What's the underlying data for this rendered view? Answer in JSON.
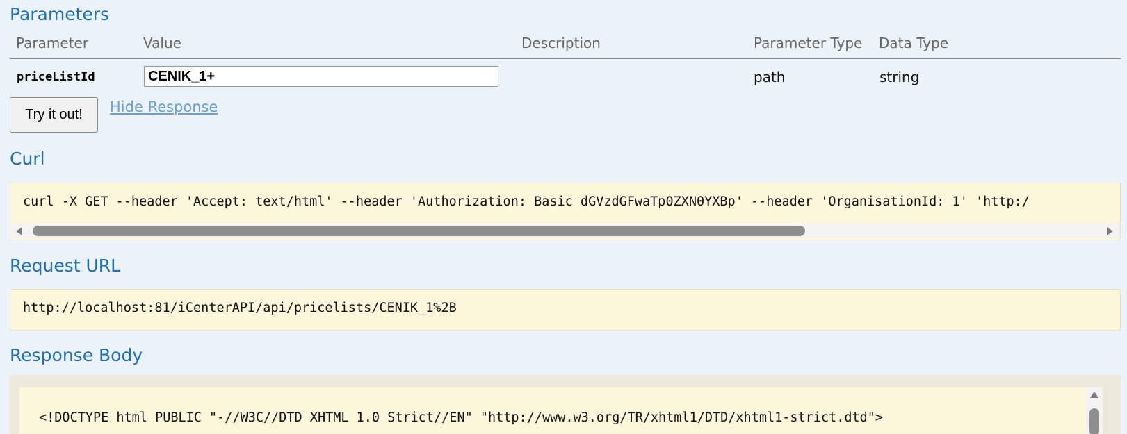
{
  "sections": {
    "parameters": "Parameters",
    "curl": "Curl",
    "request_url": "Request URL",
    "response_body": "Response Body"
  },
  "table": {
    "headers": [
      "Parameter",
      "Value",
      "Description",
      "Parameter Type",
      "Data Type"
    ],
    "rows": [
      {
        "parameter": "priceListId",
        "value": "CENIK_1+",
        "description": "",
        "parameter_type": "path",
        "data_type": "string"
      }
    ]
  },
  "actions": {
    "try_button": "Try it out!",
    "hide_response": "Hide Response"
  },
  "curl_command": "curl -X GET --header 'Accept: text/html' --header 'Authorization: Basic dGVzdGFwaTp0ZXN0YXBp' --header 'OrganisationId: 1' 'http:/",
  "request_url": "http://localhost:81/iCenterAPI/api/pricelists/CENIK_1%2B",
  "response_body_line1": "<!DOCTYPE html PUBLIC \"-//W3C//DTD XHTML 1.0 Strict//EN\" \"http://www.w3.org/TR/xhtml1/DTD/xhtml1-strict.dtd\">",
  "colors": {
    "background": "#ebf3f9",
    "heading": "#1f6fb5",
    "link": "#6aa0d6",
    "code_background": "#fcf6db"
  }
}
